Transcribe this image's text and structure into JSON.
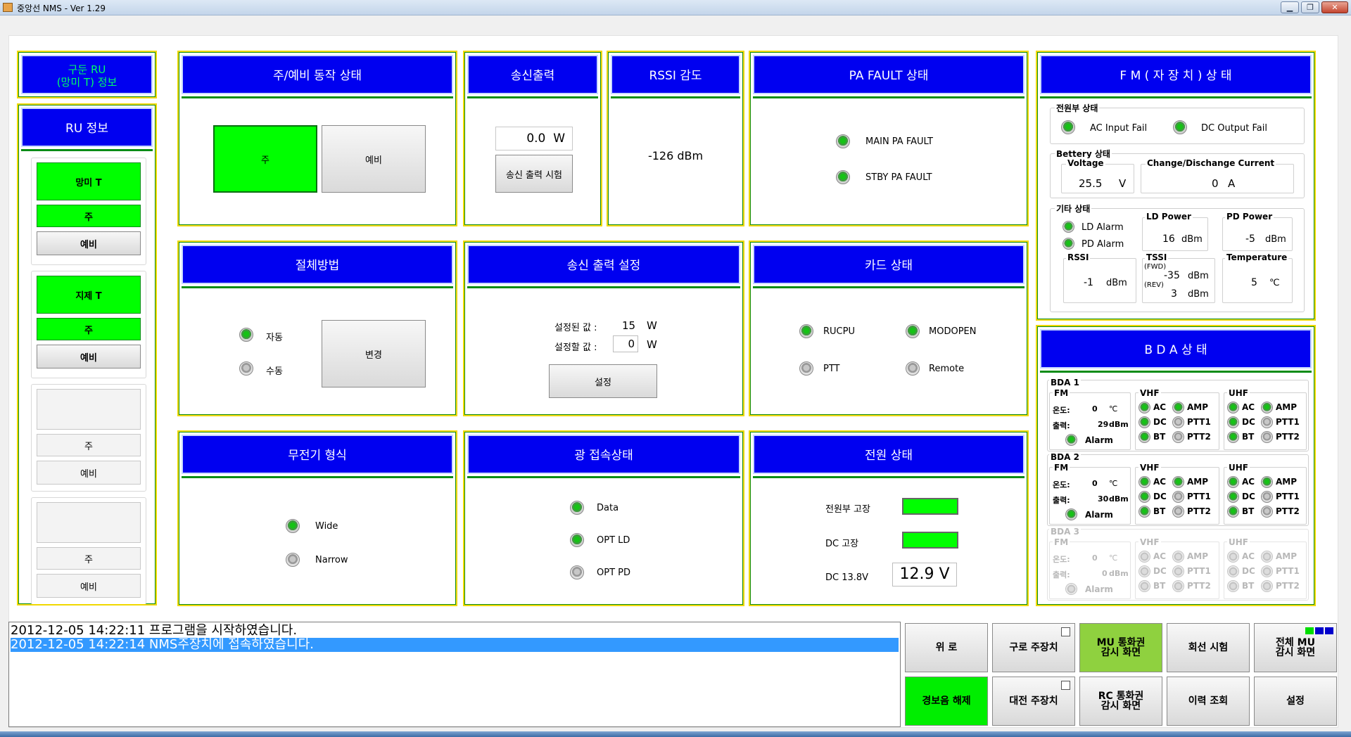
{
  "window": {
    "title": "중앙선 NMS  - Ver 1.29",
    "minimize": "▁",
    "maximize": "❐",
    "close": "✕"
  },
  "left": {
    "drive_title": "구둔 RU\n(망미 T) 정보",
    "ru_info_title": "RU 정보",
    "slots": [
      {
        "name": "망미 T",
        "main": "주",
        "standby": "예비",
        "active": true
      },
      {
        "name": "지제 T",
        "main": "주",
        "standby": "예비",
        "active": true
      },
      {
        "name": "",
        "main": "주",
        "standby": "예비",
        "active": false
      },
      {
        "name": "",
        "main": "주",
        "standby": "예비",
        "active": false
      }
    ]
  },
  "op_status": {
    "title": "주/예비 동작 상태",
    "main": "주",
    "standby": "예비"
  },
  "tx_output": {
    "title": "송신출력",
    "value": "0.0",
    "unit": "W",
    "test_btn": "송신 출력 시험"
  },
  "rssi": {
    "title": "RSSI 감도",
    "value": "-126 dBm"
  },
  "pa_fault": {
    "title": "PA FAULT 상태",
    "main": "MAIN PA FAULT",
    "stby": "STBY PA FAULT"
  },
  "fm": {
    "title": "F M ( 자 장 치 )  상 태",
    "power_section": "전원부 상태",
    "ac_fail": "AC Input Fail",
    "dc_fail": "DC Output Fail",
    "battery_section": "Bettery 상태",
    "voltage_label": "Voltage",
    "voltage": "25.5",
    "voltage_unit": "V",
    "current_label": "Change/Dischange Current",
    "current": "0",
    "current_unit": "A",
    "etc_section": "기타 상태",
    "ld_alarm": "LD Alarm",
    "pd_alarm": "PD Alarm",
    "ld_power_label": "LD Power",
    "ld_power": "16",
    "ld_unit": "dBm",
    "pd_power_label": "PD Power",
    "pd_power": "-5",
    "pd_unit": "dBm",
    "rssi_label": "RSSI",
    "rssi": "-1",
    "rssi_unit": "dBm",
    "tssi_label": "TSSI",
    "fwd": "(FWD)",
    "rev": "(REV)",
    "tssi_fwd": "-35",
    "tssi_rev": "3",
    "tssi_unit": "dBm",
    "temp_label": "Temperature",
    "temp": "5",
    "temp_unit": "℃"
  },
  "switch_method": {
    "title": "절체방법",
    "auto": "자동",
    "manual": "수동",
    "change_btn": "변경"
  },
  "tx_setting": {
    "title": "송신 출력 설정",
    "set_label": "설정된 값 :",
    "set_value": "15",
    "unit": "W",
    "input_label": "설정할 값 :",
    "input_value": "0",
    "apply_btn": "설정"
  },
  "card": {
    "title": "카드 상태",
    "rucpu": "RUCPU",
    "modopen": "MODOPEN",
    "ptt": "PTT",
    "remote": "Remote"
  },
  "bda": {
    "title": "B D A   상 태",
    "units": [
      {
        "name": "BDA 1",
        "fm": "FM",
        "temp_label": "온도:",
        "temp": "0",
        "temp_unit": "℃",
        "out_label": "출력:",
        "out": "29",
        "out_unit": "dBm",
        "alarm": "Alarm"
      },
      {
        "name": "BDA 2",
        "fm": "FM",
        "temp_label": "온도:",
        "temp": "0",
        "temp_unit": "℃",
        "out_label": "출력:",
        "out": "30",
        "out_unit": "dBm",
        "alarm": "Alarm"
      },
      {
        "name": "BDA 3",
        "fm": "FM",
        "temp_label": "온도:",
        "temp": "0",
        "temp_unit": "℃",
        "out_label": "출력:",
        "out": "0",
        "out_unit": "dBm",
        "alarm": "Alarm"
      }
    ],
    "vhf": "VHF",
    "uhf": "UHF",
    "ac": "AC",
    "amp": "AMP",
    "dc": "DC",
    "ptt1": "PTT1",
    "bt": "BT",
    "ptt2": "PTT2"
  },
  "repeater": {
    "title": "무전기 형식",
    "wide": "Wide",
    "narrow": "Narrow"
  },
  "optical": {
    "title": "광 접속상태",
    "data": "Data",
    "opt_ld": "OPT LD",
    "opt_pd": "OPT PD"
  },
  "power": {
    "title": "전원 상태",
    "psu_fault": "전원부 고장",
    "dc_fault": "DC 고장",
    "dc_label": "DC 13.8V",
    "dc_value": "12.9 V"
  },
  "log": {
    "lines": [
      "2012-12-05 14:22:11 프로그램을 시작하였습니다.",
      "2012-12-05 14:22:14 NMS주장치에 접속하였습니다."
    ]
  },
  "buttons": {
    "up": "위 로",
    "guro": "구로 주장치",
    "mu": "MU 통화권\n감시 화면",
    "line_test": "회선 시험",
    "all_mu": "전체 MU\n감시 화면",
    "alarm_off": "경보음 해제",
    "daejeon": "대전 주장치",
    "rc": "RC 통화권\n감시 화면",
    "history": "이력 조회",
    "settings": "설정"
  }
}
